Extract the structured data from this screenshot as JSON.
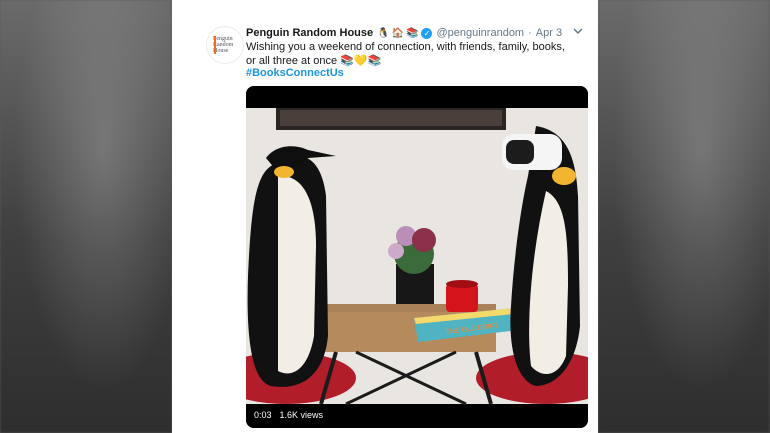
{
  "tweet": {
    "display_name": "Penguin Random House",
    "name_emojis": [
      "🐧",
      "🏠",
      "📚"
    ],
    "handle": "@penguinrandom",
    "separator": "·",
    "date": "Apr 3",
    "text": "Wishing you a weekend of connection, with friends, family, books, or all three at once 📚💛📚",
    "hashtag": "#BooksConnectUs",
    "avatar_lines": [
      "Penguin",
      "Random",
      "House"
    ]
  },
  "video": {
    "elapsed": "0:03",
    "views": "1.6K views",
    "book_title": "THE OLD DRIFT"
  },
  "colors": {
    "link": "#1b95e0",
    "verified": "#1da1f2",
    "secondary_text": "#657786",
    "avatar_accent": "#f26b21"
  },
  "icons": [
    "verified-badge-icon",
    "chevron-down-icon"
  ]
}
